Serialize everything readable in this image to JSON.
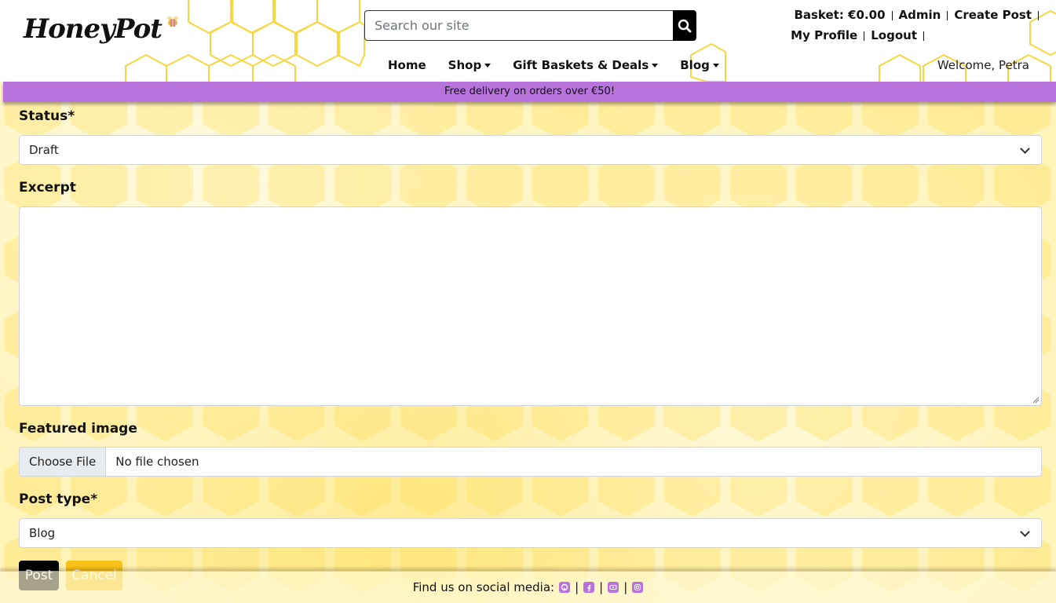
{
  "brand": {
    "name": "HoneyPot"
  },
  "search": {
    "placeholder": "Search our site"
  },
  "account": {
    "basket": "Basket: €0.00",
    "admin": "Admin",
    "create_post": "Create Post",
    "my_profile": "My Profile",
    "logout": "Logout"
  },
  "nav": {
    "home": "Home",
    "shop": "Shop",
    "gifts": "Gift Baskets & Deals",
    "blog": "Blog"
  },
  "welcome": "Welcome, Petra",
  "promo": "Free delivery on orders over €50!",
  "form": {
    "status_label": "Status*",
    "status_value": "Draft",
    "excerpt_label": "Excerpt",
    "featured_label": "Featured image",
    "choose_file": "Choose File",
    "no_file": "No file chosen",
    "post_type_label": "Post type*",
    "post_type_value": "Blog",
    "post_button": "Post",
    "cancel_button": "Cancel"
  },
  "footer": {
    "text": "Find us on social media:"
  },
  "colors": {
    "accent_purple": "#b873dc",
    "honey_yellow": "#f5d742",
    "black": "#000000"
  },
  "icons": [
    "search-icon",
    "bee-icon",
    "github-icon",
    "facebook-icon",
    "youtube-icon",
    "instagram-icon"
  ]
}
